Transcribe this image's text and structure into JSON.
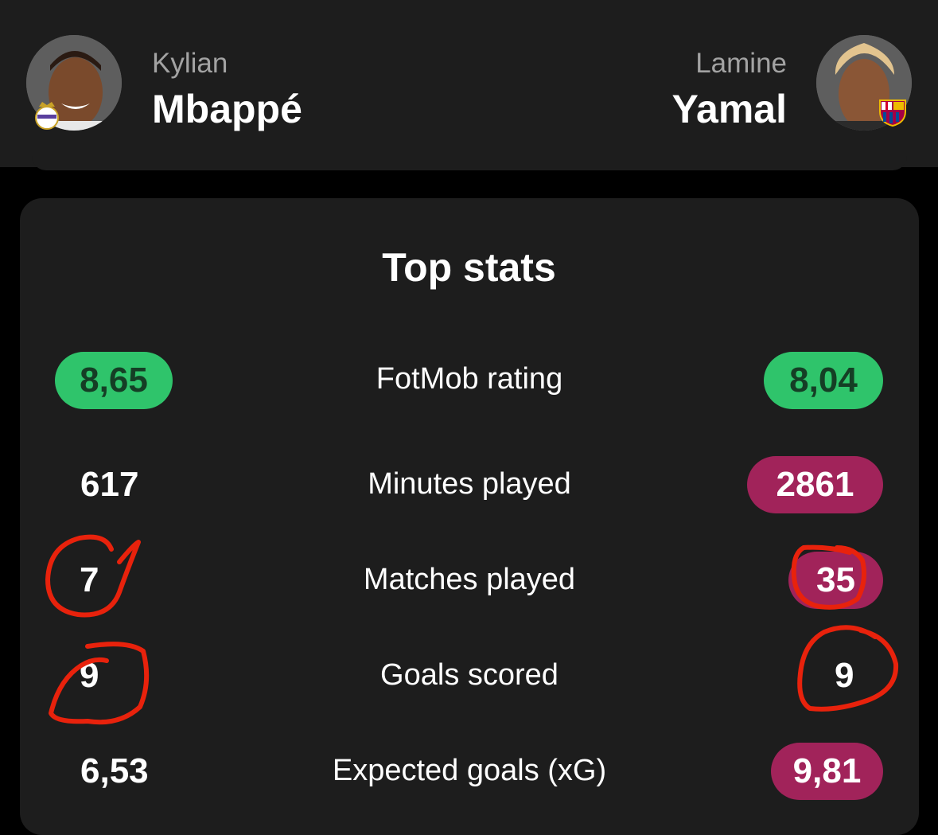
{
  "players": {
    "left": {
      "first_name": "Kylian",
      "last_name": "Mbappé",
      "club_badge": "real-madrid-crest"
    },
    "right": {
      "first_name": "Lamine",
      "last_name": "Yamal",
      "club_badge": "fc-barcelona-crest"
    }
  },
  "card": {
    "title": "Top stats",
    "rows": [
      {
        "label": "FotMob rating",
        "left": "8,65",
        "right": "8,04",
        "highlight": "both-green"
      },
      {
        "label": "Minutes played",
        "left": "617",
        "right": "2861",
        "highlight": "right"
      },
      {
        "label": "Matches played",
        "left": "7",
        "right": "35",
        "highlight": "right"
      },
      {
        "label": "Goals scored",
        "left": "9",
        "right": "9",
        "highlight": "none"
      },
      {
        "label": "Expected goals (xG)",
        "left": "6,53",
        "right": "9,81",
        "highlight": "right"
      }
    ]
  },
  "colors": {
    "background": "#000000",
    "panel": "#1d1d1d",
    "rating_green": "#2fc46b",
    "highlight_purple": "#a1235a",
    "annotation_red": "#e8220c"
  }
}
